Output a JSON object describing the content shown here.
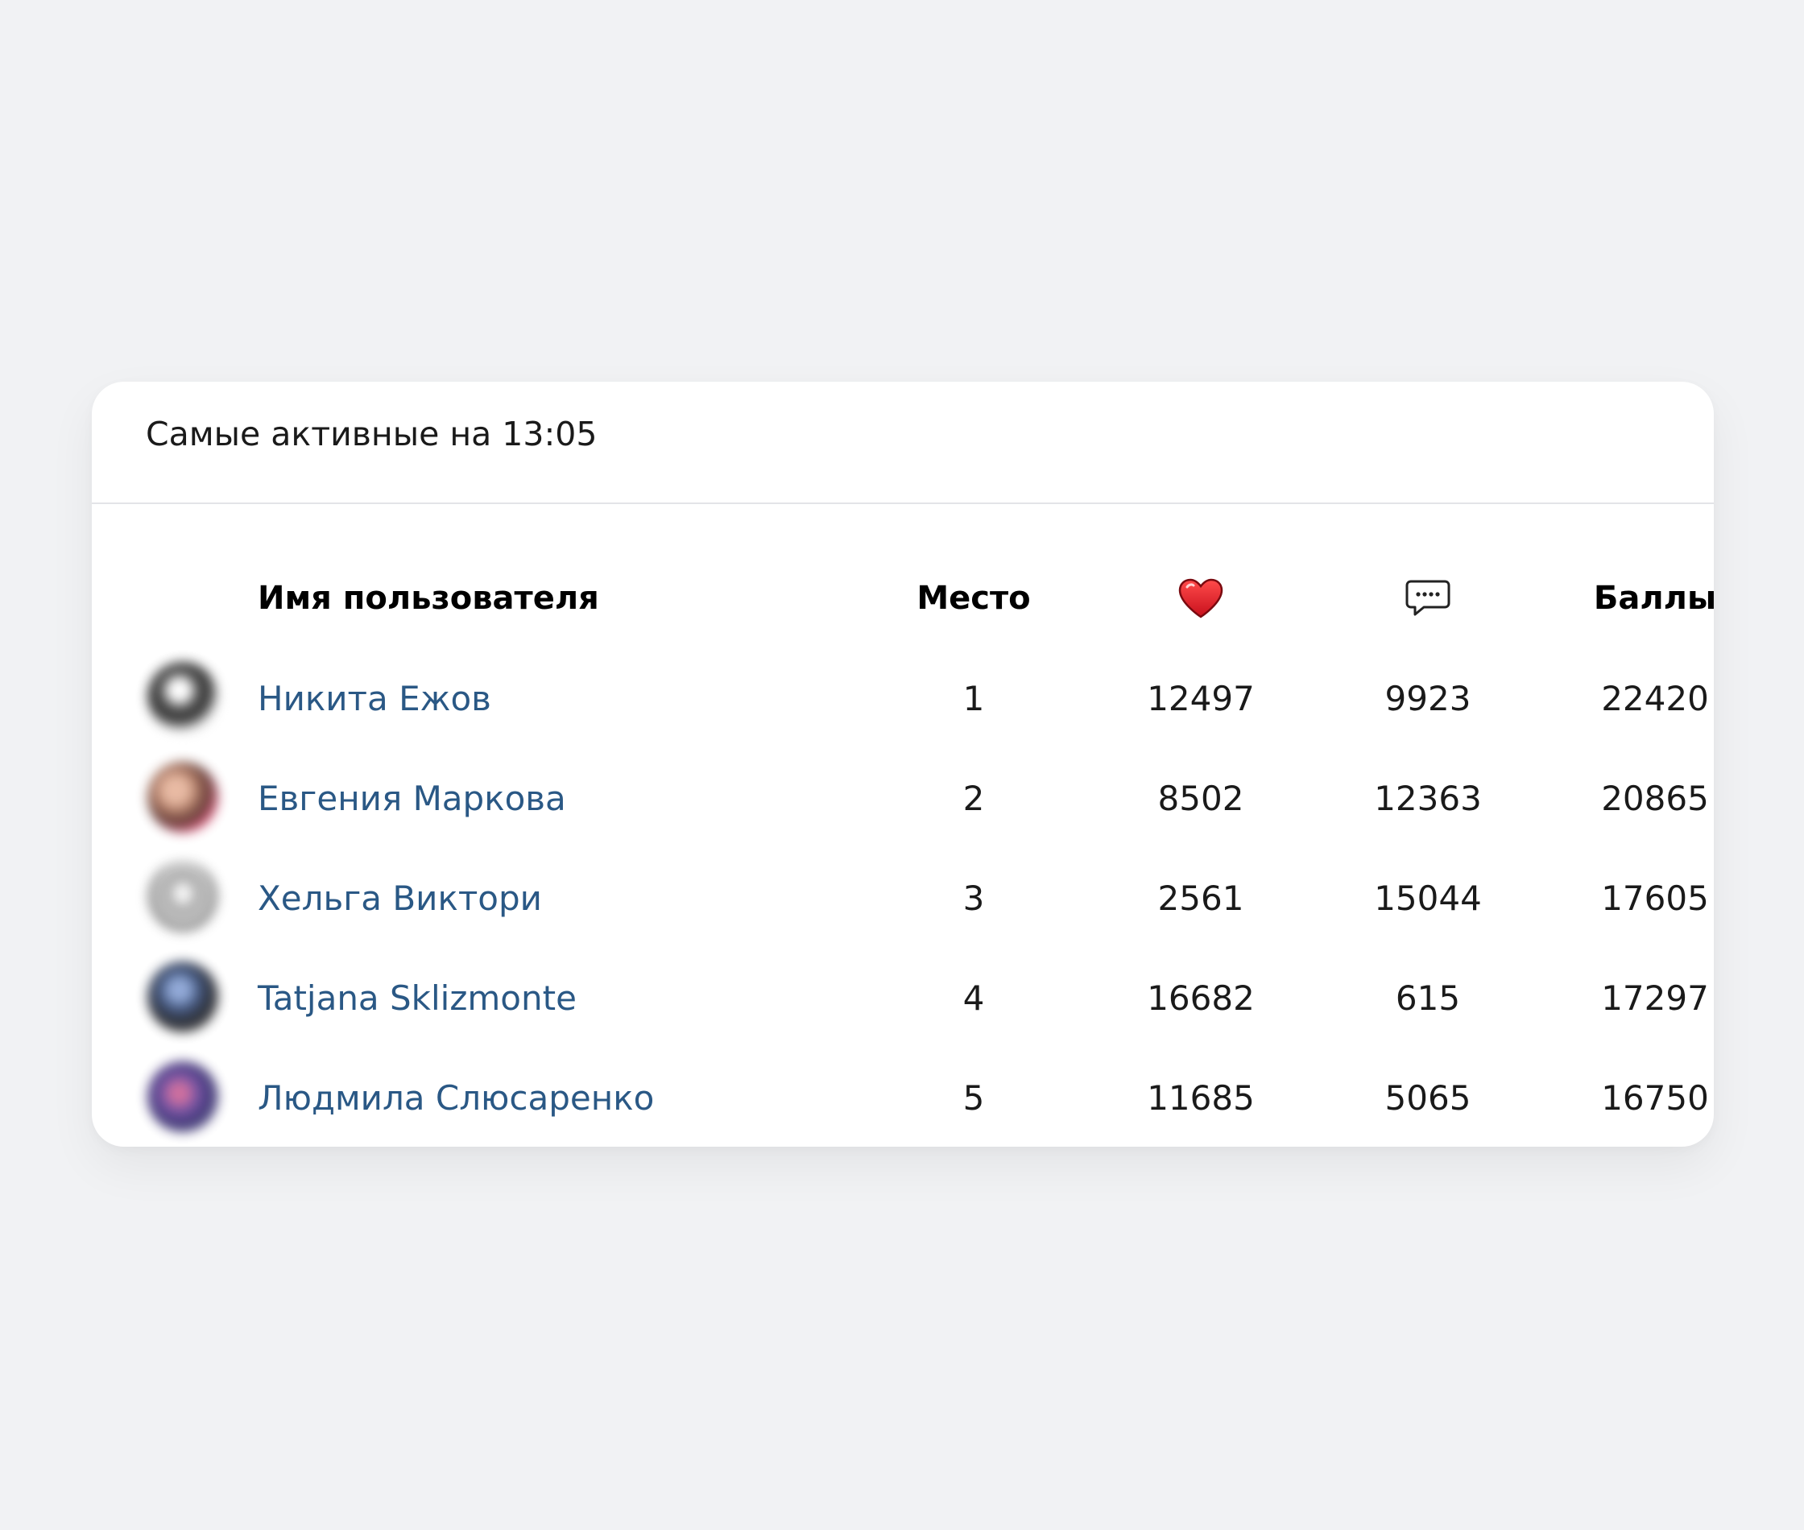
{
  "widget": {
    "title": "Самые активные на 13:05"
  },
  "table": {
    "columns": {
      "name": "Имя пользователя",
      "place": "Место",
      "likes_icon": "heart-icon",
      "comments_icon": "comment-icon",
      "score": "Баллы"
    },
    "rows": [
      {
        "name": "Никита Ежов",
        "place": "1",
        "likes": "12497",
        "comments": "9923",
        "score": "22420"
      },
      {
        "name": "Евгения Маркова",
        "place": "2",
        "likes": "8502",
        "comments": "12363",
        "score": "20865"
      },
      {
        "name": "Хельга Виктори",
        "place": "3",
        "likes": "2561",
        "comments": "15044",
        "score": "17605"
      },
      {
        "name": "Tatjana Sklizmonte",
        "place": "4",
        "likes": "16682",
        "comments": "615",
        "score": "17297"
      },
      {
        "name": "Людмила Слюсаренко",
        "place": "5",
        "likes": "11685",
        "comments": "5065",
        "score": "16750"
      }
    ]
  },
  "colors": {
    "background": "#f1f2f4",
    "card": "#ffffff",
    "link": "#2a5885",
    "heart": "#e8212d"
  }
}
